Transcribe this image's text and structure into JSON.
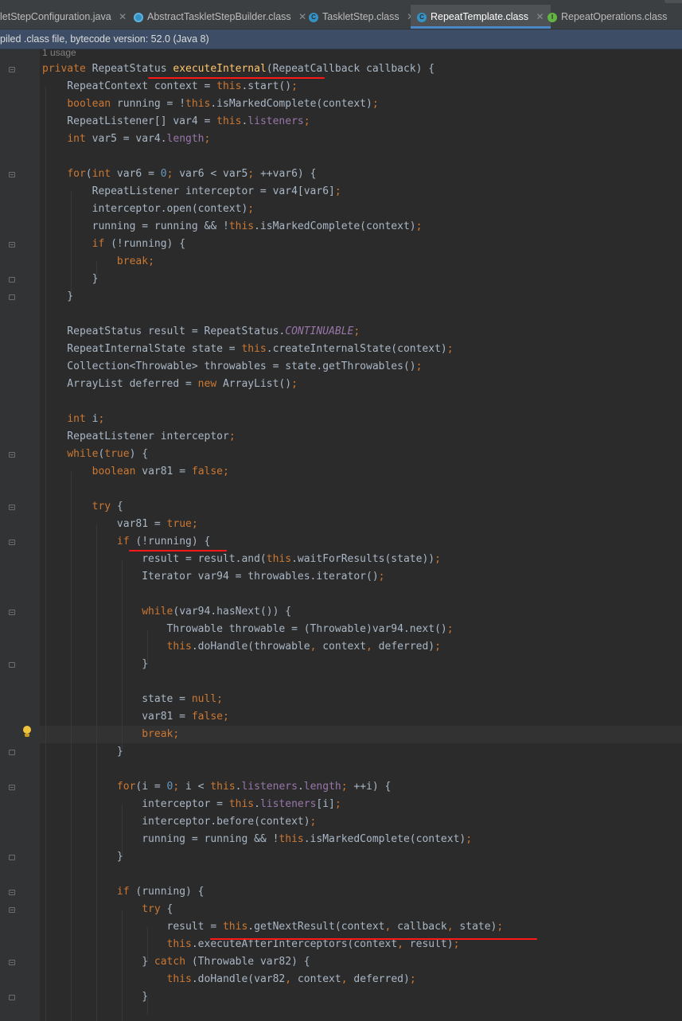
{
  "tabs": [
    {
      "label": "letStepConfiguration.java",
      "icon": "none",
      "active": false
    },
    {
      "label": "AbstractTaskletStepBuilder.class",
      "icon": "abstract-class-icon",
      "active": false
    },
    {
      "label": "TaskletStep.class",
      "icon": "class-icon",
      "active": false
    },
    {
      "label": "RepeatTemplate.class",
      "icon": "class-icon",
      "active": true
    },
    {
      "label": "RepeatOperations.class",
      "icon": "interface-icon",
      "active": false
    }
  ],
  "banner": {
    "text": "piled .class file, bytecode version: 52.0 (Java 8)"
  },
  "usage_hint": "1 usage",
  "code_lines": [
    "private RepeatStatus executeInternal(RepeatCallback callback) {",
    "    RepeatContext context = this.start();",
    "    boolean running = !this.isMarkedComplete(context);",
    "    RepeatListener[] var4 = this.listeners;",
    "    int var5 = var4.length;",
    "",
    "    for(int var6 = 0; var6 < var5; ++var6) {",
    "        RepeatListener interceptor = var4[var6];",
    "        interceptor.open(context);",
    "        running = running && !this.isMarkedComplete(context);",
    "        if (!running) {",
    "            break;",
    "        }",
    "    }",
    "",
    "    RepeatStatus result = RepeatStatus.CONTINUABLE;",
    "    RepeatInternalState state = this.createInternalState(context);",
    "    Collection<Throwable> throwables = state.getThrowables();",
    "    ArrayList deferred = new ArrayList();",
    "",
    "    int i;",
    "    RepeatListener interceptor;",
    "    while(true) {",
    "        boolean var81 = false;",
    "",
    "        try {",
    "            var81 = true;",
    "            if (!running) {",
    "                result = result.and(this.waitForResults(state));",
    "                Iterator var94 = throwables.iterator();",
    "",
    "                while(var94.hasNext()) {",
    "                    Throwable throwable = (Throwable)var94.next();",
    "                    this.doHandle(throwable, context, deferred);",
    "                }",
    "",
    "                state = null;",
    "                var81 = false;",
    "                break;",
    "            }",
    "",
    "            for(i = 0; i < this.listeners.length; ++i) {",
    "                interceptor = this.listeners[i];",
    "                interceptor.before(context);",
    "                running = running && !this.isMarkedComplete(context);",
    "            }",
    "",
    "            if (running) {",
    "                try {",
    "                    result = this.getNextResult(context, callback, state);",
    "                    this.executeAfterInterceptors(context, result);",
    "                } catch (Throwable var82) {",
    "                    this.doHandle(var82, context, deferred);",
    "                }"
  ]
}
